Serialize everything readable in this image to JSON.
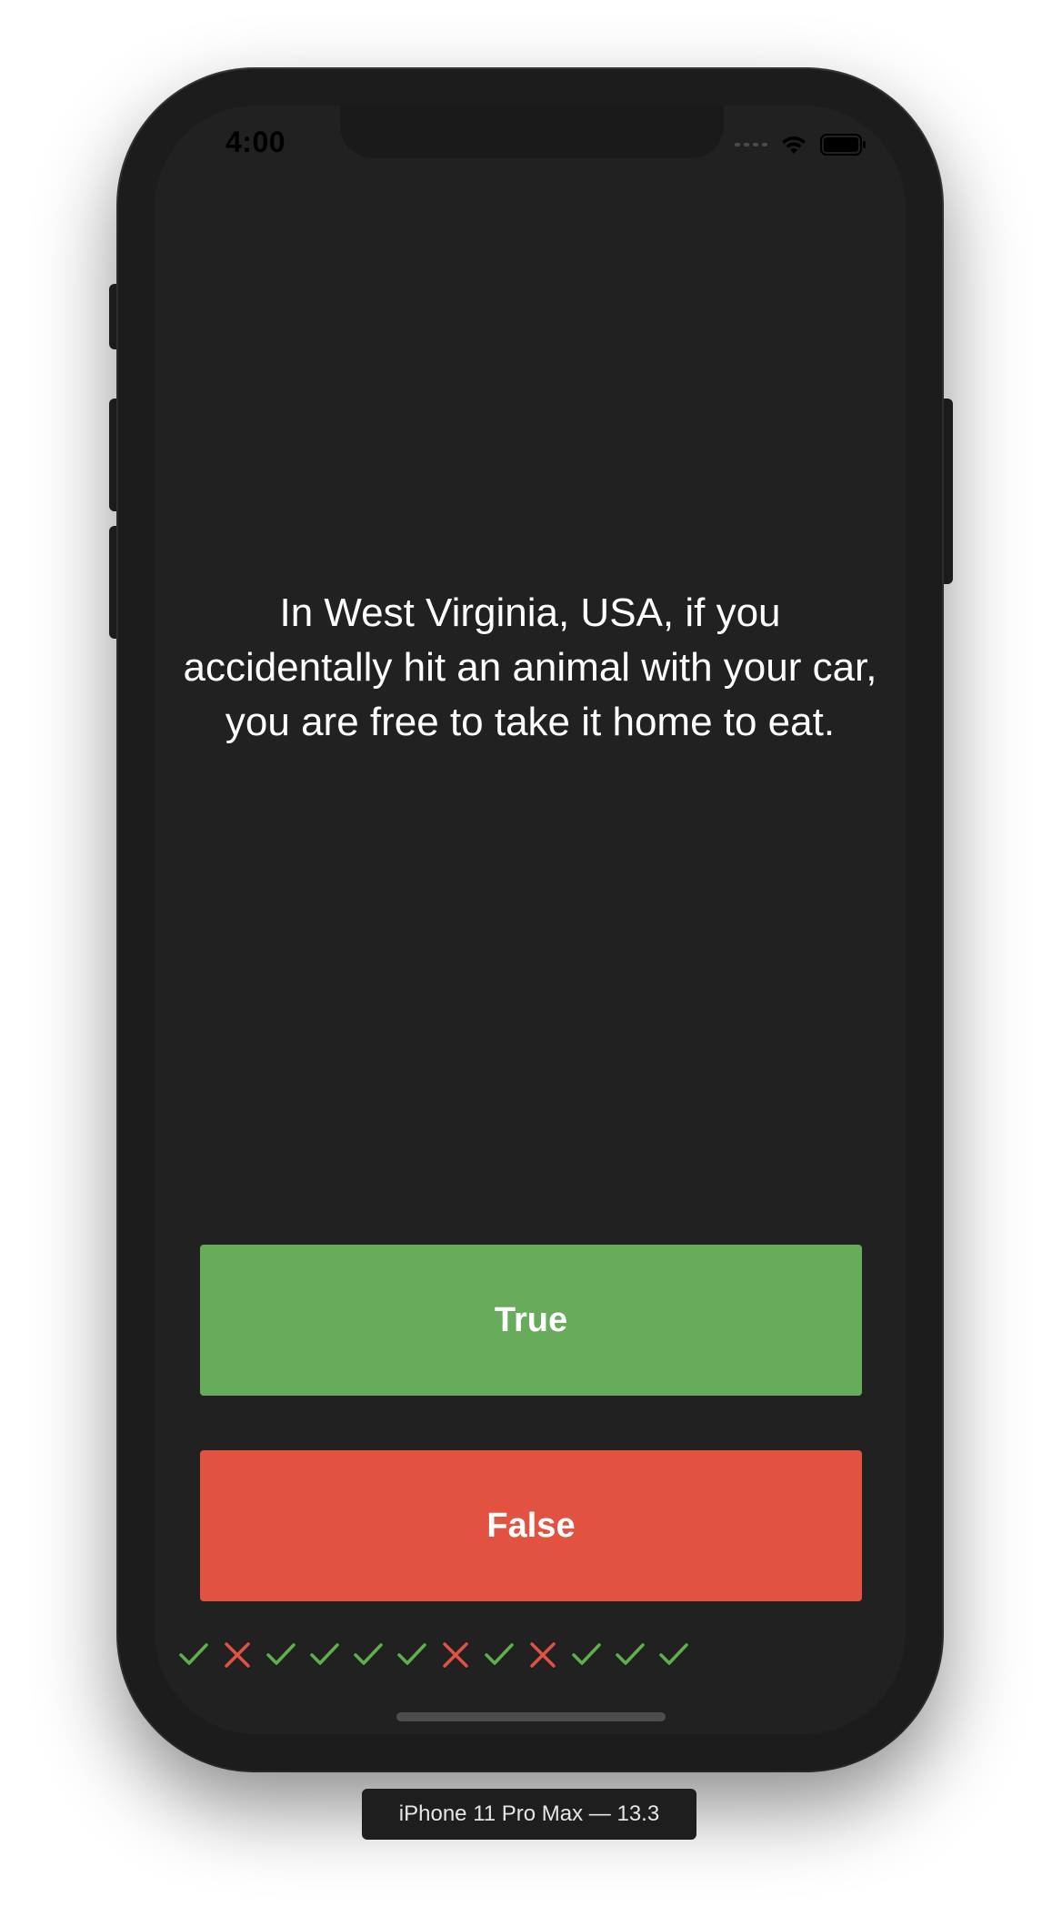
{
  "status_bar": {
    "time": "4:00",
    "icons": [
      "cellular-signal-icon",
      "wifi-icon",
      "battery-icon"
    ]
  },
  "quiz": {
    "question": "In West Virginia, USA, if you accidentally hit an animal with your car, you are free to take it home to eat.",
    "true_label": "True",
    "false_label": "False",
    "score_marks": [
      "correct",
      "wrong",
      "correct",
      "correct",
      "correct",
      "correct",
      "wrong",
      "correct",
      "wrong",
      "correct",
      "correct",
      "correct"
    ]
  },
  "simulator": {
    "device_label": "iPhone 11 Pro Max — 13.3"
  },
  "colors": {
    "true_button": "#67ac5b",
    "false_button": "#e15241",
    "correct_mark": "#5fae51",
    "wrong_mark": "#e15241",
    "screen_background": "#212121"
  }
}
